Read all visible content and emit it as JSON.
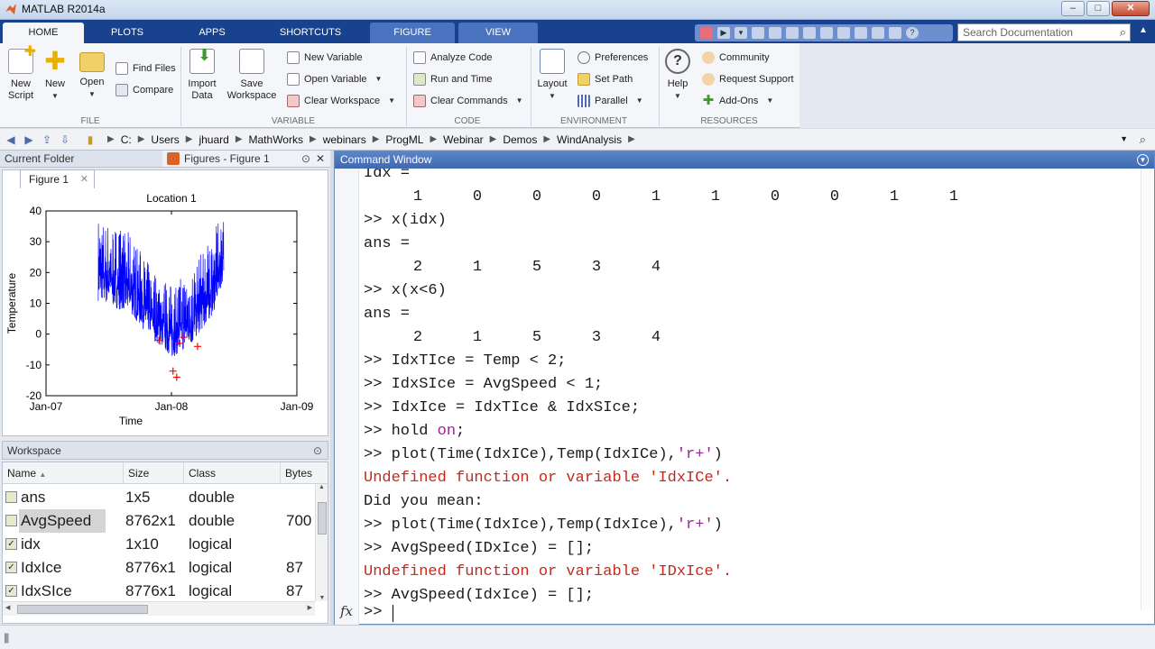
{
  "window": {
    "title": "MATLAB R2014a"
  },
  "ribbon": {
    "tabs": [
      "HOME",
      "PLOTS",
      "APPS",
      "SHORTCUTS",
      "FIGURE",
      "VIEW"
    ],
    "search_placeholder": "Search Documentation",
    "file": {
      "label": "FILE",
      "new_script": "New\nScript",
      "new": "New",
      "open": "Open",
      "find_files": "Find Files",
      "compare": "Compare"
    },
    "variable": {
      "label": "VARIABLE",
      "import_data": "Import\nData",
      "save_workspace": "Save\nWorkspace",
      "new_variable": "New Variable",
      "open_variable": "Open Variable",
      "clear_workspace": "Clear Workspace"
    },
    "code": {
      "label": "CODE",
      "analyze_code": "Analyze Code",
      "run_and_time": "Run and Time",
      "clear_commands": "Clear Commands"
    },
    "environment": {
      "label": "ENVIRONMENT",
      "layout": "Layout",
      "preferences": "Preferences",
      "set_path": "Set Path",
      "parallel": "Parallel"
    },
    "resources": {
      "label": "RESOURCES",
      "help": "Help",
      "community": "Community",
      "request_support": "Request Support",
      "add_ons": "Add-Ons"
    }
  },
  "path": {
    "crumbs": [
      "C:",
      "Users",
      "jhuard",
      "MathWorks",
      "webinars",
      "ProgML",
      "Webinar",
      "Demos",
      "WindAnalysis"
    ]
  },
  "left": {
    "current_folder": "Current Folder",
    "figures_title": "Figures - Figure 1",
    "figure_tab": "Figure 1",
    "workspace_title": "Workspace",
    "workspace_columns": [
      "Name",
      "Size",
      "Class",
      "Bytes"
    ],
    "workspace_rows": [
      {
        "name": "ans",
        "size": "1x5",
        "class": "double",
        "bytes": ""
      },
      {
        "name": "AvgSpeed",
        "size": "8762x1",
        "class": "double",
        "bytes": "700"
      },
      {
        "name": "idx",
        "size": "1x10",
        "class": "logical",
        "bytes": ""
      },
      {
        "name": "IdxIce",
        "size": "8776x1",
        "class": "logical",
        "bytes": "87"
      },
      {
        "name": "IdxSIce",
        "size": "8776x1",
        "class": "logical",
        "bytes": "87"
      }
    ]
  },
  "chart_data": {
    "type": "line",
    "title": "Location 1",
    "xlabel": "Time",
    "ylabel": "Temperature",
    "x_ticks": [
      "Jan-07",
      "Jan-08",
      "Jan-09"
    ],
    "y_ticks": [
      40,
      30,
      20,
      10,
      0,
      -10,
      -20
    ],
    "ylim": [
      -20,
      40
    ],
    "series": [
      {
        "color": "#0000ff",
        "approx_envelope": [
          {
            "x": "Jun-07",
            "min": 6,
            "max": 38
          },
          {
            "x": "Sep-07",
            "min": 2,
            "max": 33
          },
          {
            "x": "Nov-07",
            "min": -5,
            "max": 22
          },
          {
            "x": "Jan-08",
            "min": -12,
            "max": 16
          },
          {
            "x": "Mar-08",
            "min": -8,
            "max": 22
          },
          {
            "x": "May-08",
            "min": 2,
            "max": 33
          },
          {
            "x": "Jun-08",
            "min": 14,
            "max": 40
          }
        ]
      },
      {
        "color": "#ff0000",
        "marker": "+",
        "points": [
          {
            "x": "Dec-07",
            "y": -2
          },
          {
            "x": "Jan-08",
            "y": -12
          },
          {
            "x": "Jan-08",
            "y": -14
          },
          {
            "x": "Feb-08",
            "y": -3
          },
          {
            "x": "Feb-08",
            "y": -1
          },
          {
            "x": "Mar-08",
            "y": -4
          }
        ]
      }
    ]
  },
  "command": {
    "title": "Command Window",
    "lines": [
      {
        "kind": "text",
        "text": "Idx ="
      },
      {
        "kind": "vals",
        "values": [
          "1",
          "0",
          "0",
          "0",
          "1",
          "1",
          "0",
          "0",
          "1",
          "1"
        ]
      },
      {
        "kind": "cmd",
        "text": ">> x(idx)"
      },
      {
        "kind": "text",
        "text": "ans ="
      },
      {
        "kind": "vals",
        "values": [
          "2",
          "1",
          "5",
          "3",
          "4"
        ]
      },
      {
        "kind": "cmd",
        "text": ">> x(x<6)"
      },
      {
        "kind": "text",
        "text": "ans ="
      },
      {
        "kind": "vals",
        "values": [
          "2",
          "1",
          "5",
          "3",
          "4"
        ]
      },
      {
        "kind": "cmd",
        "text": ">> IdxTIce = Temp < 2;"
      },
      {
        "kind": "cmd",
        "text": ">> IdxSIce = AvgSpeed < 1;"
      },
      {
        "kind": "cmd",
        "text": ">> IdxIce = IdxTIce & IdxSIce;"
      },
      {
        "kind": "cmd_hold",
        "text": ">> hold ",
        "kw": "on",
        "tail": ";"
      },
      {
        "kind": "cmd_str",
        "text": ">> plot(Time(IdxICe),Temp(IdxICe),",
        "str": "'r+'",
        "tail": ")"
      },
      {
        "kind": "err",
        "text": "Undefined function or variable 'IdxICe'."
      },
      {
        "kind": "text",
        "text": "Did you mean:"
      },
      {
        "kind": "cmd_str",
        "text": ">> plot(Time(IdxIce),Temp(IdxIce),",
        "str": "'r+'",
        "tail": ")"
      },
      {
        "kind": "cmd",
        "text": ">> AvgSpeed(IDxIce) = [];"
      },
      {
        "kind": "err",
        "text": "Undefined function or variable 'IDxIce'."
      },
      {
        "kind": "cmd",
        "text": ">> AvgSpeed(IdxIce) = [];"
      }
    ],
    "prompt": ">>",
    "fx": "fx"
  }
}
